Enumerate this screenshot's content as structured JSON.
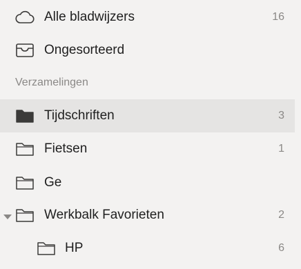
{
  "sidebar": {
    "top_items": [
      {
        "label": "Alle bladwijzers",
        "count": "16",
        "icon": "cloud-icon"
      },
      {
        "label": "Ongesorteerd",
        "count": "",
        "icon": "tray-icon"
      }
    ],
    "section_header": "Verzamelingen",
    "collections": [
      {
        "label": "Tijdschriften",
        "count": "3",
        "icon": "folder-filled-icon",
        "selected": true
      },
      {
        "label": "Fietsen",
        "count": "1",
        "icon": "folder-icon"
      },
      {
        "label": "Ge",
        "count": "",
        "icon": "folder-icon"
      },
      {
        "label": "Werkbalk Favorieten",
        "count": "2",
        "icon": "folder-icon",
        "expanded": true
      },
      {
        "label": "HP",
        "count": "6",
        "icon": "folder-icon",
        "nested": true
      }
    ]
  },
  "colors": {
    "background": "#f3f2f1",
    "selected_row": "#e5e4e3",
    "text": "#1f1f1f",
    "muted_text": "#8a8886"
  }
}
